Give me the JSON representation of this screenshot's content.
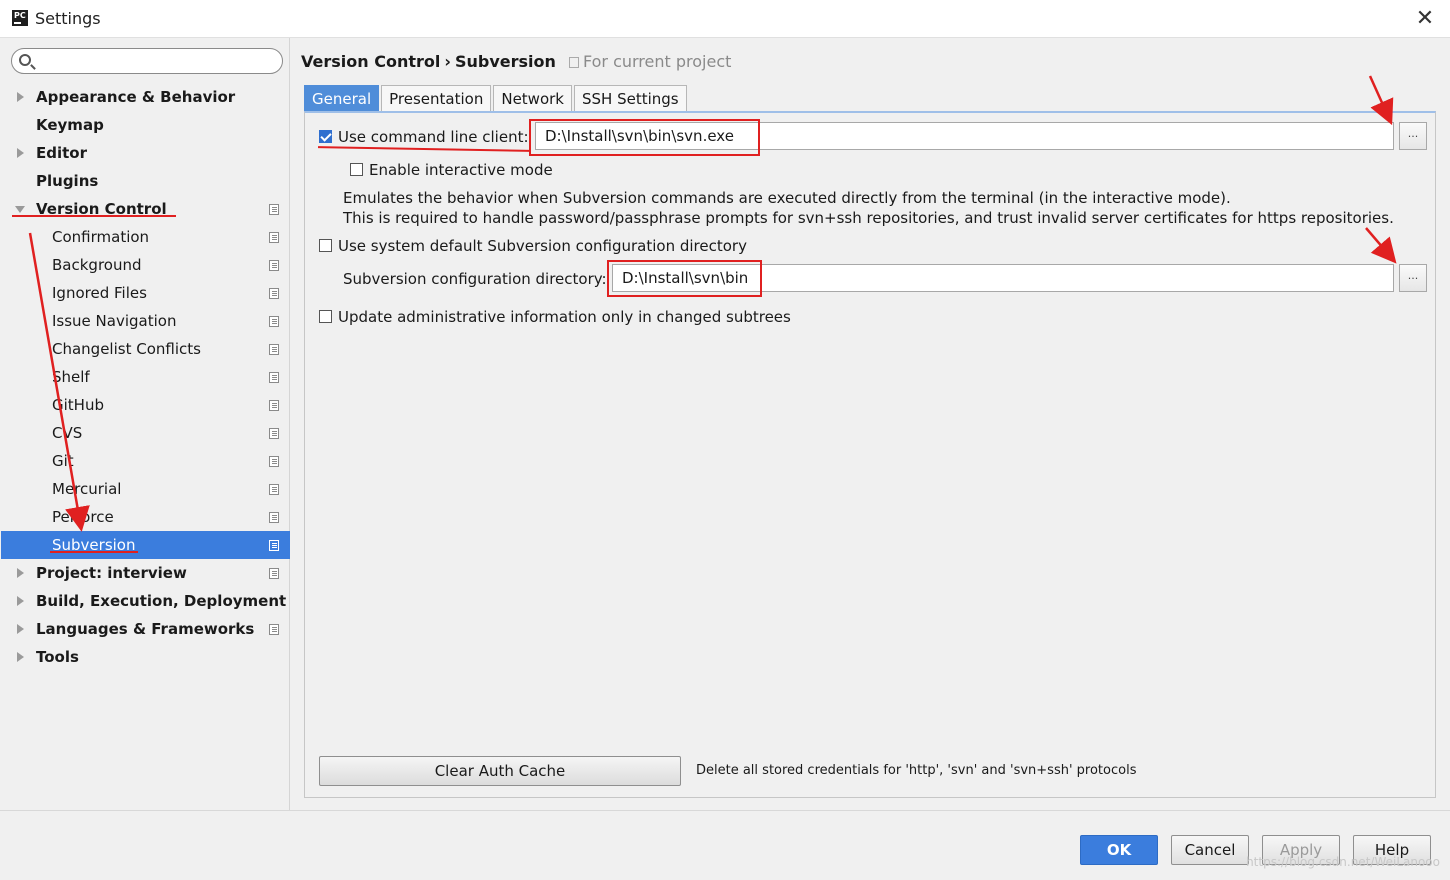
{
  "window": {
    "title": "Settings",
    "icon_text": "PC"
  },
  "sidebar": {
    "search": {
      "value": ""
    },
    "items": [
      {
        "label": "Appearance & Behavior",
        "level": "top",
        "expand": "collapsed",
        "proj": false
      },
      {
        "label": "Keymap",
        "level": "top",
        "expand": "none",
        "proj": false
      },
      {
        "label": "Editor",
        "level": "top",
        "expand": "collapsed",
        "proj": false
      },
      {
        "label": "Plugins",
        "level": "top",
        "expand": "none",
        "proj": false
      },
      {
        "label": "Version Control",
        "level": "top",
        "expand": "expanded",
        "proj": true
      },
      {
        "label": "Confirmation",
        "level": "child",
        "proj": true
      },
      {
        "label": "Background",
        "level": "child",
        "proj": true
      },
      {
        "label": "Ignored Files",
        "level": "child",
        "proj": true
      },
      {
        "label": "Issue Navigation",
        "level": "child",
        "proj": true
      },
      {
        "label": "Changelist Conflicts",
        "level": "child",
        "proj": true
      },
      {
        "label": "Shelf",
        "level": "child",
        "proj": true
      },
      {
        "label": "GitHub",
        "level": "child",
        "proj": true
      },
      {
        "label": "CVS",
        "level": "child",
        "proj": true
      },
      {
        "label": "Git",
        "level": "child",
        "proj": true
      },
      {
        "label": "Mercurial",
        "level": "child",
        "proj": true
      },
      {
        "label": "Perforce",
        "level": "child",
        "proj": true
      },
      {
        "label": "Subversion",
        "level": "child",
        "proj": true,
        "selected": true
      },
      {
        "label": "Project: interview",
        "level": "top",
        "expand": "collapsed",
        "proj": true
      },
      {
        "label": "Build, Execution, Deployment",
        "level": "top",
        "expand": "collapsed",
        "proj": false
      },
      {
        "label": "Languages & Frameworks",
        "level": "top",
        "expand": "collapsed",
        "proj": true
      },
      {
        "label": "Tools",
        "level": "top",
        "expand": "collapsed",
        "proj": false
      }
    ]
  },
  "breadcrumb": {
    "part1": "Version Control",
    "sep": "›",
    "part2": "Subversion",
    "scope": "For current project"
  },
  "tabs": [
    "General",
    "Presentation",
    "Network",
    "SSH Settings"
  ],
  "general": {
    "use_cmd_label": "Use command line client:",
    "use_cmd_checked": true,
    "cmd_path": "D:\\Install\\svn\\bin\\svn.exe",
    "interactive_label": "Enable interactive mode",
    "interactive_checked": false,
    "desc_line1": "Emulates the behavior when Subversion commands are executed directly from the terminal (in the interactive mode).",
    "desc_line2": "This is required to handle password/passphrase prompts for svn+ssh repositories, and trust invalid server certificates for https repositories.",
    "sysdefault_label": "Use system default Subversion configuration directory",
    "sysdefault_checked": false,
    "config_dir_label": "Subversion configuration directory:",
    "config_dir_path": "D:\\Install\\svn\\bin",
    "update_admin_label": "Update administrative information only in changed subtrees",
    "update_admin_checked": false,
    "browse_label": "...",
    "clear_cache_label": "Clear Auth Cache",
    "clear_cache_desc": "Delete all stored credentials for 'http', 'svn' and 'svn+ssh' protocols"
  },
  "footer": {
    "ok": "OK",
    "cancel": "Cancel",
    "apply": "Apply",
    "help": "Help",
    "watermark": "https://blog.csdn.net/WeiLanooo"
  },
  "colors": {
    "accent": "#3b7ddd",
    "annotation": "#e02020"
  }
}
